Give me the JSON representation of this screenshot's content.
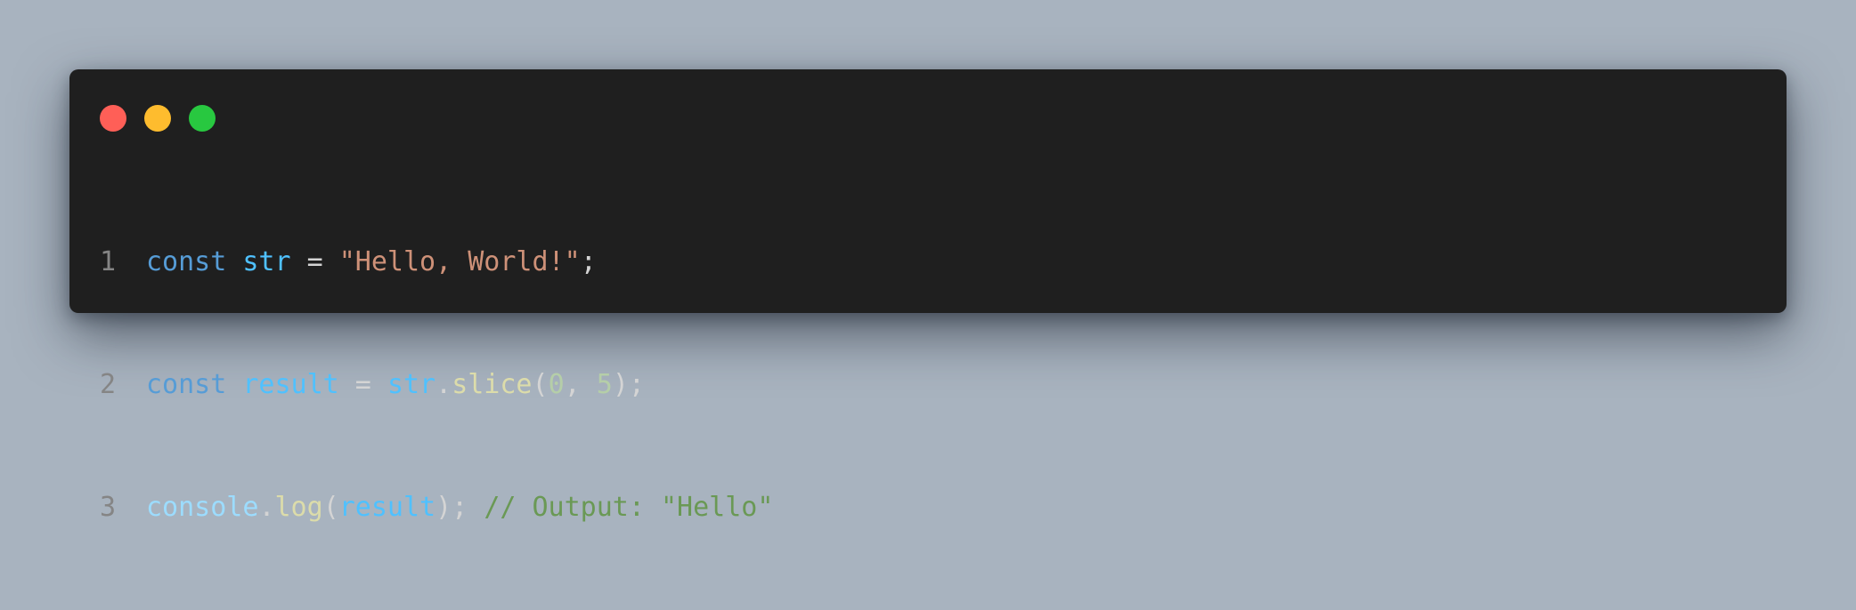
{
  "window": {
    "controls": [
      {
        "name": "close",
        "color": "#ff5f57"
      },
      {
        "name": "minimize",
        "color": "#febc2e"
      },
      {
        "name": "maximize",
        "color": "#28c840"
      }
    ]
  },
  "code": {
    "lines": [
      {
        "number": "1",
        "tokens": {
          "t1": "const",
          "t2": " ",
          "t3": "str",
          "t4": " = ",
          "t5": "\"Hello, World!\"",
          "t6": ";"
        }
      },
      {
        "number": "2",
        "tokens": {
          "t1": "const",
          "t2": " ",
          "t3": "result",
          "t4": " = ",
          "t5": "str",
          "t6": ".",
          "t7": "slice",
          "t8": "(",
          "t9": "0",
          "t10": ", ",
          "t11": "5",
          "t12": ");"
        }
      },
      {
        "number": "3",
        "tokens": {
          "t1": "console",
          "t2": ".",
          "t3": "log",
          "t4": "(",
          "t5": "result",
          "t6": "); ",
          "t7": "// Output: \"Hello\""
        }
      }
    ]
  },
  "colors": {
    "background": "#a8b3bf",
    "editor_background": "#1f1f1f",
    "keyword": "#569cd6",
    "variable": "#4fc1ff",
    "function": "#dcdcaa",
    "string": "#ce9178",
    "number": "#b5cea8",
    "comment": "#6a9955",
    "line_number": "#858585"
  }
}
